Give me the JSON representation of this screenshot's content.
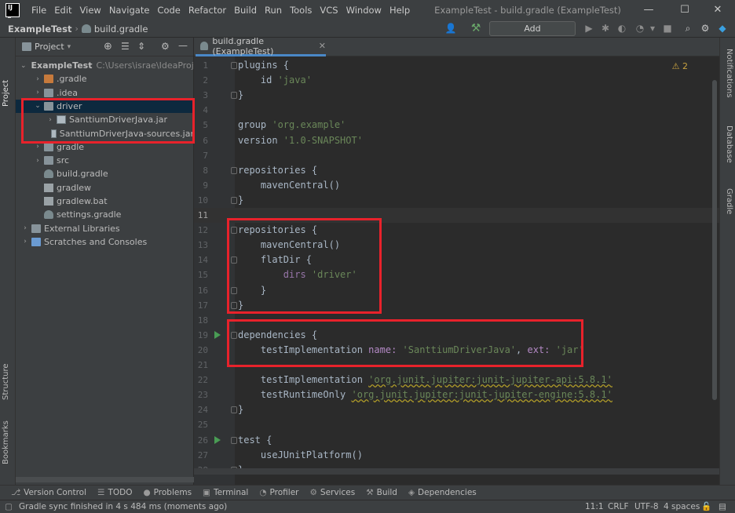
{
  "titlebar": {
    "menus": [
      "File",
      "Edit",
      "View",
      "Navigate",
      "Code",
      "Refactor",
      "Build",
      "Run",
      "Tools",
      "VCS",
      "Window",
      "Help"
    ],
    "window_title": "ExampleTest - build.gradle (ExampleTest)",
    "minimize": "—",
    "maximize": "☐",
    "close": "✕"
  },
  "navbar": {
    "project": "ExampleTest",
    "file": "build.gradle",
    "config_button": "Add Configuration..."
  },
  "side_stripes": {
    "left": [
      "Project",
      "Structure",
      "Bookmarks"
    ],
    "right": [
      "Notifications",
      "Database",
      "Gradle"
    ]
  },
  "project_panel": {
    "header": "Project",
    "tree": [
      {
        "label": "ExampleTest",
        "hint": "C:\\Users\\israe\\IdeaProjects",
        "arrow": "⌄",
        "icon": "folder blue",
        "depth": 0
      },
      {
        "label": ".gradle",
        "hint": "",
        "arrow": "›",
        "icon": "folder orange",
        "depth": 1
      },
      {
        "label": ".idea",
        "hint": "",
        "arrow": "›",
        "icon": "folder",
        "depth": 1
      },
      {
        "label": "driver",
        "hint": "",
        "arrow": "⌄",
        "icon": "folder",
        "depth": 1,
        "selected": true
      },
      {
        "label": "SanttiumDriverJava.jar",
        "hint": "",
        "arrow": "›",
        "icon": "jar",
        "depth": 2
      },
      {
        "label": "SanttiumDriverJava-sources.jar",
        "hint": "",
        "arrow": "",
        "icon": "jar",
        "depth": 2
      },
      {
        "label": "gradle",
        "hint": "",
        "arrow": "›",
        "icon": "folder",
        "depth": 1
      },
      {
        "label": "src",
        "hint": "",
        "arrow": "›",
        "icon": "folder",
        "depth": 1
      },
      {
        "label": "build.gradle",
        "hint": "",
        "arrow": "",
        "icon": "gradleicon",
        "depth": 1
      },
      {
        "label": "gradlew",
        "hint": "",
        "arrow": "",
        "icon": "fileicon",
        "depth": 1
      },
      {
        "label": "gradlew.bat",
        "hint": "",
        "arrow": "",
        "icon": "fileicon",
        "depth": 1
      },
      {
        "label": "settings.gradle",
        "hint": "",
        "arrow": "",
        "icon": "gradleicon",
        "depth": 1
      },
      {
        "label": "External Libraries",
        "hint": "",
        "arrow": "›",
        "icon": "folder",
        "depth": 0
      },
      {
        "label": "Scratches and Consoles",
        "hint": "",
        "arrow": "›",
        "icon": "folder blue",
        "depth": 0
      }
    ]
  },
  "editor": {
    "tab_label": "build.gradle (ExampleTest)",
    "warning_count": "2",
    "current_line": 11,
    "lines": [
      {
        "n": "1",
        "tokens": [
          [
            "plugins {",
            ""
          ]
        ]
      },
      {
        "n": "2",
        "tokens": [
          [
            "    id ",
            ""
          ],
          [
            "'java'",
            "str"
          ]
        ]
      },
      {
        "n": "3",
        "tokens": [
          [
            "}",
            ""
          ]
        ]
      },
      {
        "n": "4",
        "tokens": []
      },
      {
        "n": "5",
        "tokens": [
          [
            "group ",
            ""
          ],
          [
            "'org.example'",
            "str"
          ]
        ]
      },
      {
        "n": "6",
        "tokens": [
          [
            "version ",
            ""
          ],
          [
            "'1.0-SNAPSHOT'",
            "str"
          ]
        ]
      },
      {
        "n": "7",
        "tokens": []
      },
      {
        "n": "8",
        "tokens": [
          [
            "repositories {",
            ""
          ]
        ]
      },
      {
        "n": "9",
        "tokens": [
          [
            "    mavenCentral()",
            ""
          ]
        ]
      },
      {
        "n": "10",
        "tokens": [
          [
            "}",
            ""
          ]
        ]
      },
      {
        "n": "11",
        "tokens": []
      },
      {
        "n": "12",
        "tokens": [
          [
            "repositories {",
            ""
          ]
        ]
      },
      {
        "n": "13",
        "tokens": [
          [
            "    mavenCentral()",
            ""
          ]
        ]
      },
      {
        "n": "14",
        "tokens": [
          [
            "    flatDir {",
            ""
          ]
        ]
      },
      {
        "n": "15",
        "tokens": [
          [
            "        dirs ",
            "param"
          ],
          [
            "'driver'",
            "str"
          ]
        ]
      },
      {
        "n": "16",
        "tokens": [
          [
            "    }",
            ""
          ]
        ]
      },
      {
        "n": "17",
        "tokens": [
          [
            "}",
            ""
          ]
        ]
      },
      {
        "n": "18",
        "tokens": []
      },
      {
        "n": "19",
        "tokens": [
          [
            "dependencies {",
            ""
          ]
        ],
        "run": true
      },
      {
        "n": "20",
        "tokens": [
          [
            "    testImplementation ",
            ""
          ],
          [
            "name: ",
            "named"
          ],
          [
            "'SanttiumDriverJava'",
            "str"
          ],
          [
            ", ",
            ""
          ],
          [
            "ext: ",
            "named"
          ],
          [
            "'jar'",
            "str"
          ]
        ]
      },
      {
        "n": "21",
        "tokens": []
      },
      {
        "n": "22",
        "tokens": [
          [
            "    testImplementation ",
            ""
          ],
          [
            "'org.junit.jupiter:junit-jupiter-api:5.8.1'",
            "warnstr"
          ]
        ]
      },
      {
        "n": "23",
        "tokens": [
          [
            "    testRuntimeOnly ",
            ""
          ],
          [
            "'org.junit.jupiter:junit-jupiter-engine:5.8.1'",
            "warnstr"
          ]
        ]
      },
      {
        "n": "24",
        "tokens": [
          [
            "}",
            ""
          ]
        ]
      },
      {
        "n": "25",
        "tokens": []
      },
      {
        "n": "26",
        "tokens": [
          [
            "test {",
            ""
          ]
        ],
        "run": true
      },
      {
        "n": "27",
        "tokens": [
          [
            "    useJUnitPlatform()",
            ""
          ]
        ]
      },
      {
        "n": "28",
        "tokens": [
          [
            "}",
            ""
          ]
        ]
      }
    ]
  },
  "bottom_tools": [
    {
      "icon": "⎇",
      "label": "Version Control"
    },
    {
      "icon": "☰",
      "label": "TODO"
    },
    {
      "icon": "●",
      "label": "Problems"
    },
    {
      "icon": "▣",
      "label": "Terminal"
    },
    {
      "icon": "◔",
      "label": "Profiler"
    },
    {
      "icon": "⚙",
      "label": "Services"
    },
    {
      "icon": "⚒",
      "label": "Build"
    },
    {
      "icon": "◈",
      "label": "Dependencies"
    }
  ],
  "status": {
    "message": "Gradle sync finished in 4 s 484 ms (moments ago)",
    "position": "11:1",
    "line_sep": "CRLF",
    "encoding": "UTF-8",
    "indent": "4 spaces"
  },
  "colors": {
    "highlight_box": "#e8222b",
    "accent": "#4a88c7",
    "run": "#499c54"
  }
}
